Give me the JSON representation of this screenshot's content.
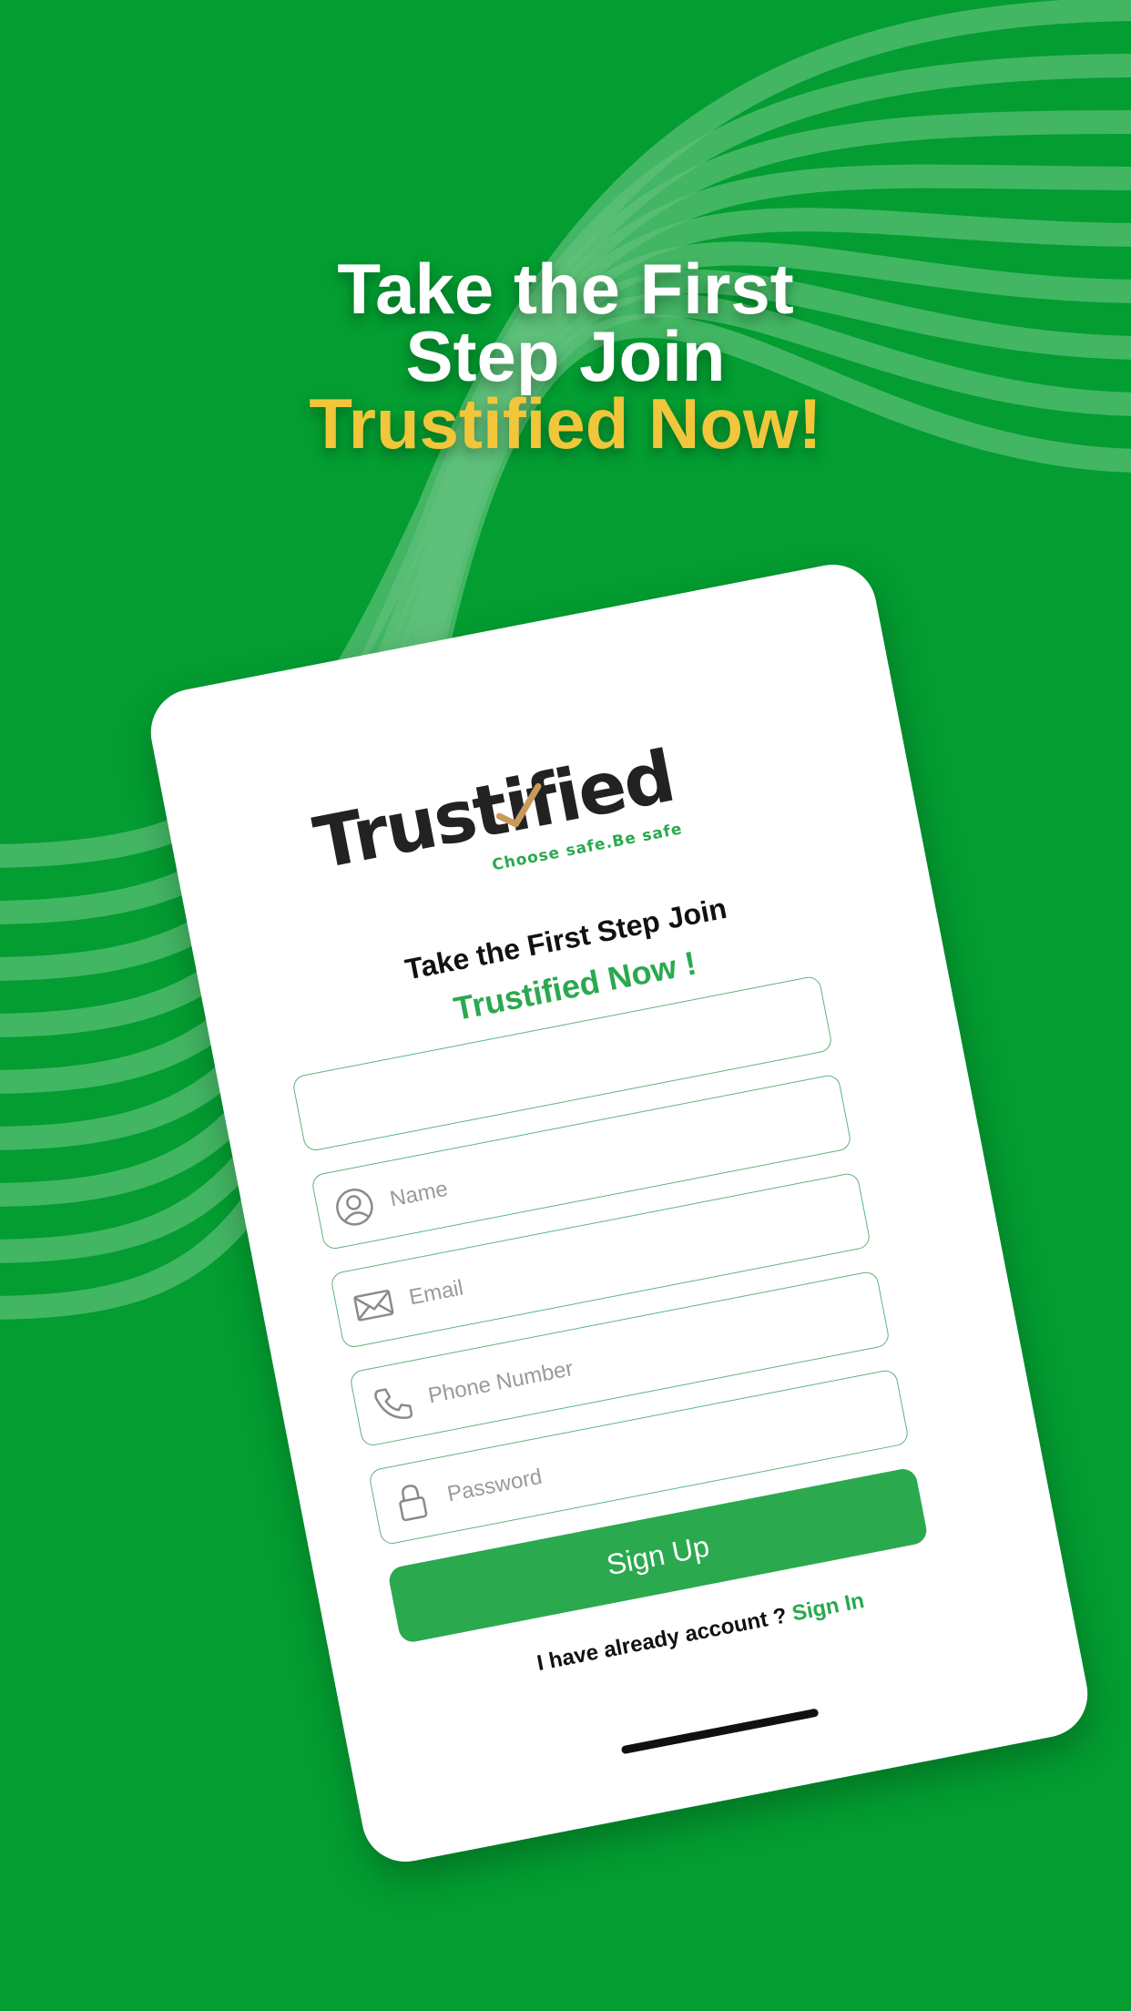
{
  "headline": {
    "line1": "Take the First",
    "line2": "Step Join",
    "accent": "Trustified Now!"
  },
  "logo": {
    "wordmark": "Trustified",
    "tagline": "Choose safe.Be safe"
  },
  "form": {
    "title": "Take the First Step Join",
    "subtitle": "Trustified Now !",
    "fields": [
      {
        "placeholder": "Name",
        "icon": "user-icon"
      },
      {
        "placeholder": "Email",
        "icon": "envelope-icon"
      },
      {
        "placeholder": "Phone Number",
        "icon": "phone-icon"
      },
      {
        "placeholder": "Password",
        "icon": "lock-icon"
      }
    ],
    "submit_label": "Sign Up",
    "signin_prompt": "I have already account ?",
    "signin_link": "Sign In"
  },
  "colors": {
    "background": "#039d31",
    "accent_yellow": "#f1c63a",
    "brand_green": "#2aa94f",
    "stripe": "#5fc07a"
  }
}
